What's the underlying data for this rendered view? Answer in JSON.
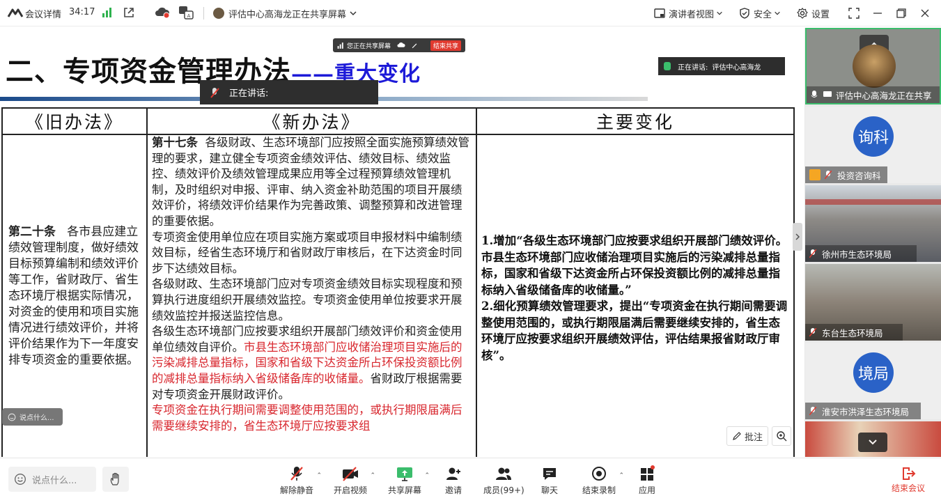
{
  "titlebar": {
    "meeting_title": "会议详情",
    "timer": "34:17",
    "share_status": "评估中心高海龙正在共享屏幕",
    "speaker_view": "演讲者视图",
    "security": "安全",
    "settings": "设置"
  },
  "share_overlay": {
    "pill_text": "您正在共享屏幕",
    "stop_label": "结束共享",
    "speaking_label_top": "正在讲话:",
    "speaking_name_top": "评估中心高海龙",
    "speaking_label": "正在讲话:"
  },
  "slide": {
    "title_main": "二、专项资金管理办法",
    "title_dash": "——",
    "title_accent": "重大变化",
    "headers": [
      "《旧办法》",
      "《新办法》",
      "主要变化"
    ],
    "old": {
      "clause": "第二十条",
      "text": "各市县应建立绩效管理制度，做好绩效目标预算编制和绩效评价等工作，省财政厅、省生态环境厅根据实际情况，对资金的使用和项目实施情况进行绩效评价，并将评价结果作为下一年度安排专项资金的重要依据。"
    },
    "new": {
      "clause": "第十七条",
      "p1": "各级财政、生态环境部门应按照全面实施预算绩效管理的要求，建立健全专项资金绩效评估、绩效目标、绩效监控、绩效评价及绩效管理成果应用等全过程预算绩效管理机制，及时组织对申报、评审、纳入资金补助范围的项目开展绩效评价，将绩效评价结果作为完善政策、调整预算和改进管理的重要依据。",
      "p2": "专项资金使用单位应在项目实施方案或项目申报材料中编制绩效目标，经省生态环境厅和省财政厅审核后，在下达资金时同步下达绩效目标。",
      "p3": "各级财政、生态环境部门应对专项资金绩效目标实现程度和预算执行进度组织开展绩效监控。专项资金使用单位按要求开展绩效监控并报送监控信息。",
      "p4_a": "各级生态环境部门应按要求组织开展部门绩效评价和资金使用单位绩效自评价。",
      "p4_red": "市县生态环境部门应收储治理项目实施后的污染减排总量指标，国家和省级下达资金所占环保投资额比例的减排总量指标纳入省级储备库的收储量。",
      "p4_b": "省财政厅根据需要对专项资金开展财政评价。",
      "p5_red": "专项资金在执行期间需要调整使用范围的，或执行期限届满后需要继续安排的，省生态环境厅应按要求组"
    },
    "changes": {
      "item1": "1.增加“各级生态环境部门应按要求组织开展部门绩效评价。市县生态环境部门应收储治理项目实施后的污染减排总量指标，国家和省级下达资金所占环保投资额比例的减排总量指标纳入省级储备库的收储量。”",
      "item2": "2.细化预算绩效管理要求，提出“专项资金在执行期间需要调整使用范围的，或执行期限届满后需要继续安排的，省生态环境厅应按要求组织开展绩效评估，评估结果报省财政厅审核”。"
    }
  },
  "slide_controls": {
    "say_mini": "说点什么...",
    "annotate": "批注"
  },
  "participants": [
    {
      "name": "评估中心高海龙正在共享"
    },
    {
      "name": "投资咨询科",
      "avatar": "询科"
    },
    {
      "name": "徐州市生态环境局"
    },
    {
      "name": "东台生态环境局"
    },
    {
      "name": "淮安市洪泽生态环境局",
      "avatar": "境局"
    }
  ],
  "toolbar": {
    "say_placeholder": "说点什么...",
    "unmute": "解除静音",
    "start_video": "开启视频",
    "share_screen": "共享屏幕",
    "invite": "邀请",
    "members": "成员(99+)",
    "chat": "聊天",
    "stop_recording": "结束录制",
    "apps": "应用",
    "end_meeting": "结束会议"
  },
  "colors": {
    "accent_blue": "#1d1ad8",
    "highlight_red": "#d8262d",
    "avatar_blue": "#2a62c7",
    "share_green": "#3bbd6c",
    "end_red": "#e03a2f"
  }
}
